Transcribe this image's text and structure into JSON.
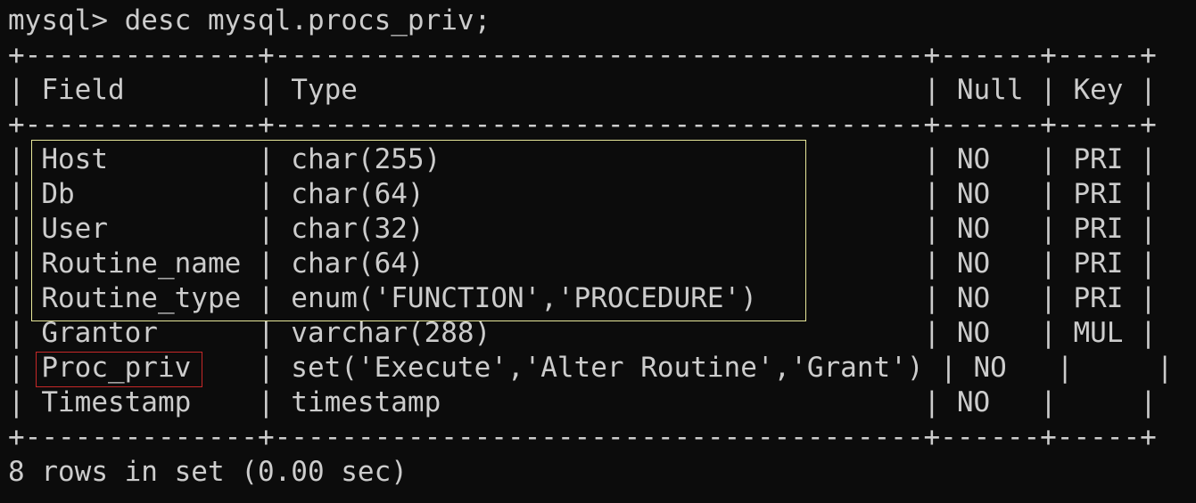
{
  "prompt": {
    "text": "mysql> desc mysql.procs_priv;"
  },
  "table": {
    "border_line": "+--------------+---------------------------------------+------+-----+",
    "header_row": "| Field        | Type                                  | Null | Key |",
    "rows": [
      {
        "text": "| Host         | char(255)                             | NO   | PRI |"
      },
      {
        "text": "| Db           | char(64)                              | NO   | PRI |"
      },
      {
        "text": "| User         | char(32)                              | NO   | PRI |"
      },
      {
        "text": "| Routine_name | char(64)                              | NO   | PRI |"
      },
      {
        "text": "| Routine_type | enum('FUNCTION','PROCEDURE')          | NO   | PRI |"
      },
      {
        "text": "| Grantor      | varchar(288)                          | NO   | MUL |"
      },
      {
        "text": "| Proc_priv    | set('Execute','Alter Routine','Grant') | NO   |     |"
      },
      {
        "text": "| Timestamp    | timestamp                             | NO   |     |"
      }
    ]
  },
  "result": {
    "text": "8 rows in set (0.00 sec)"
  },
  "annotations": {
    "yellow_box_color": "#e8e89a",
    "red_box_color": "#c62828"
  }
}
